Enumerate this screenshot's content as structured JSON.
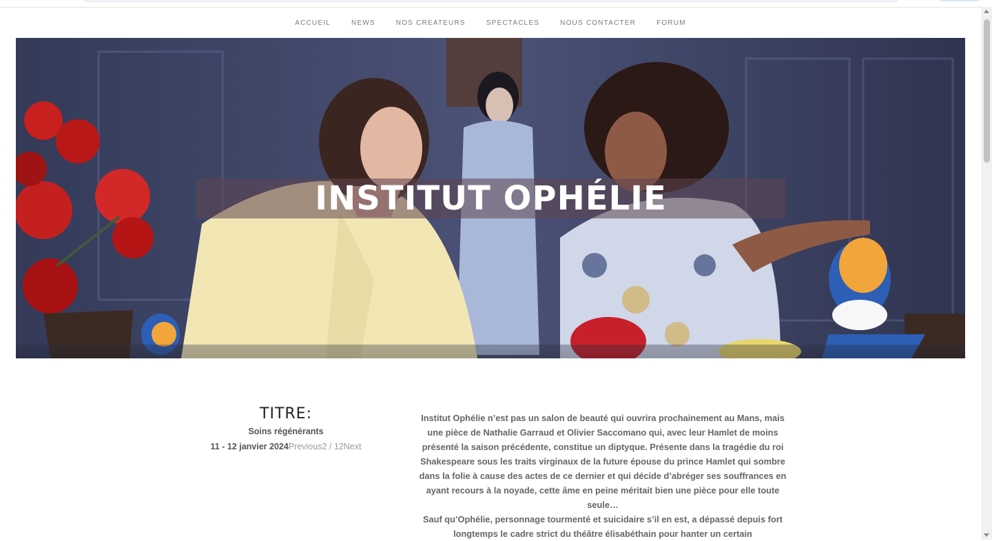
{
  "nav": {
    "items": [
      {
        "label": "ACCUEIL"
      },
      {
        "label": "NEWS"
      },
      {
        "label": "NOS CREATEURS"
      },
      {
        "label": "SPECTACLES"
      },
      {
        "label": "NOUS CONTACTER"
      },
      {
        "label": "FORUM"
      }
    ]
  },
  "hero": {
    "title": "INSTITUT OPHÉLIE"
  },
  "info": {
    "heading": "TITRE:",
    "subtitle": "Soins régénérants",
    "date": "11 - 12 janvier 2024",
    "previous": "Previous",
    "counter": "2 / 12",
    "next": "Next"
  },
  "description": {
    "paragraphs": [
      "Institut Ophélie n’est pas un salon de beauté qui ouvrira prochainement au Mans, mais une pièce de Nathalie Garraud et Olivier Saccomano qui, avec leur Hamlet de moins présenté la saison précédente, constitue un diptyque. Présente dans la tragédie du roi Shakespeare sous les traits virginaux de la future épouse du prince Hamlet qui sombre dans la folie à cause des actes de ce dernier et qui décide d’abréger ses souffrances en ayant recours à la noyade, cette âme en peine méritait bien une pièce pour elle toute seule…",
      "Sauf qu’Ophélie, personnage tourmenté et suicidaire s’il en est, a dépassé depuis fort longtemps le cadre strict du théâtre élisabéthain pour hanter un certain"
    ]
  }
}
